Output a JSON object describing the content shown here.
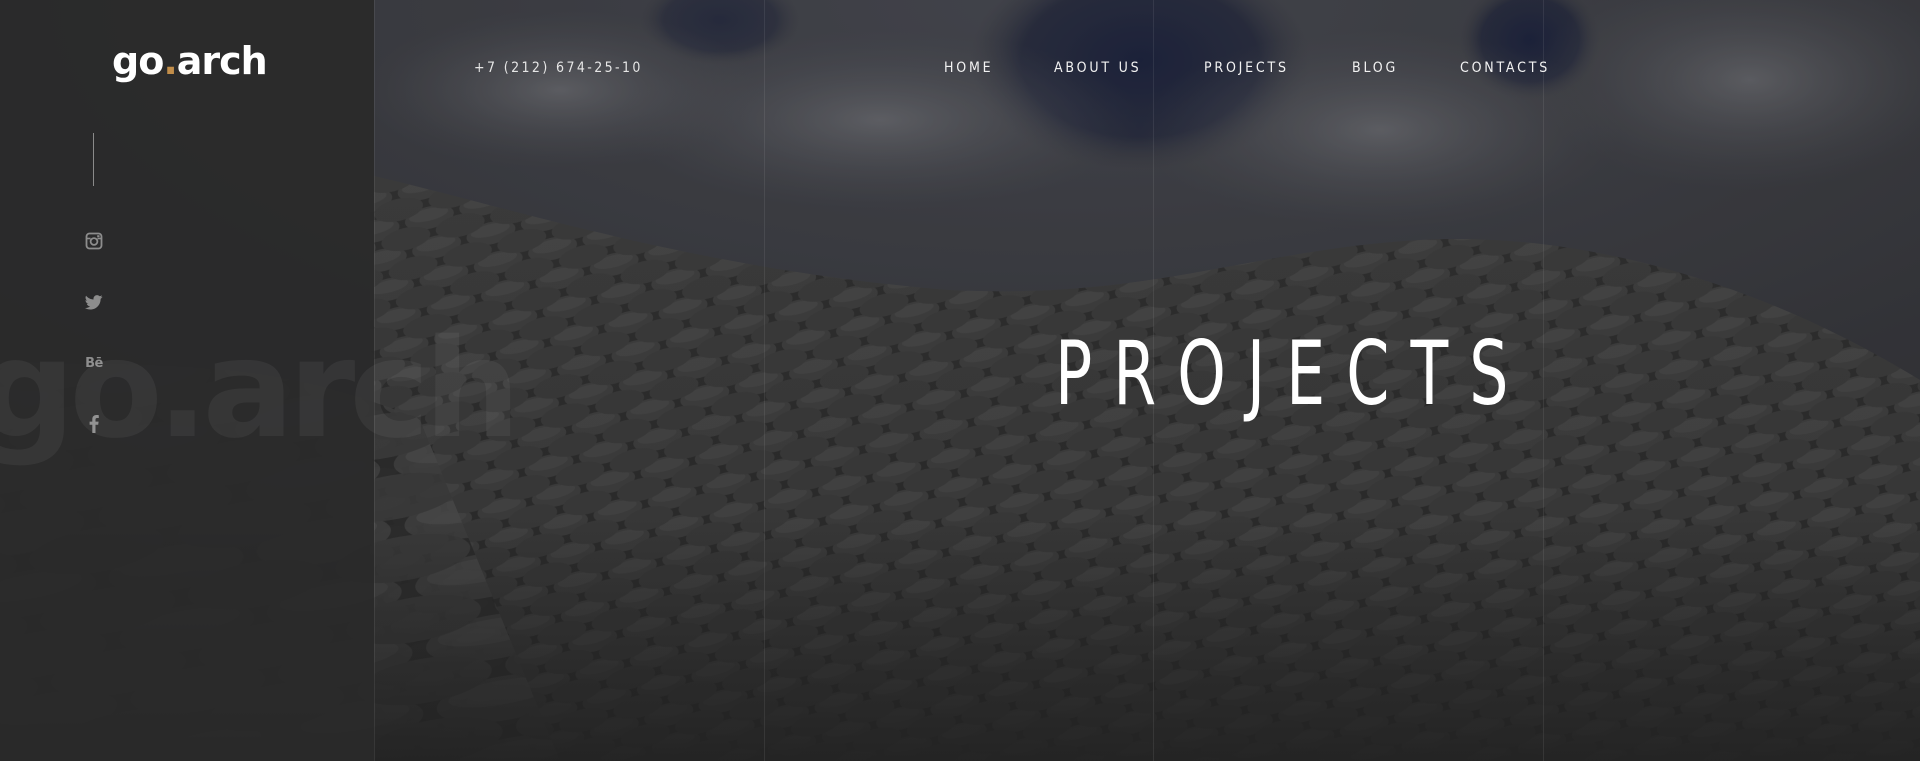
{
  "brand": {
    "logo_part1": "go",
    "logo_dot": ".",
    "logo_part2": "arch",
    "watermark": "go.arch",
    "accent_color": "#c28e4a"
  },
  "header": {
    "phone": "+7 (212) 674-25-10",
    "nav": [
      {
        "label": "HOME"
      },
      {
        "label": "ABOUT US"
      },
      {
        "label": "PROJECTS"
      },
      {
        "label": "BLOG"
      },
      {
        "label": "CONTACTS"
      }
    ]
  },
  "social": [
    {
      "icon": "instagram-icon"
    },
    {
      "icon": "twitter-icon"
    },
    {
      "icon": "behance-icon",
      "text": "Bē"
    },
    {
      "icon": "facebook-icon"
    }
  ],
  "hero": {
    "title": "PROJECTS"
  }
}
